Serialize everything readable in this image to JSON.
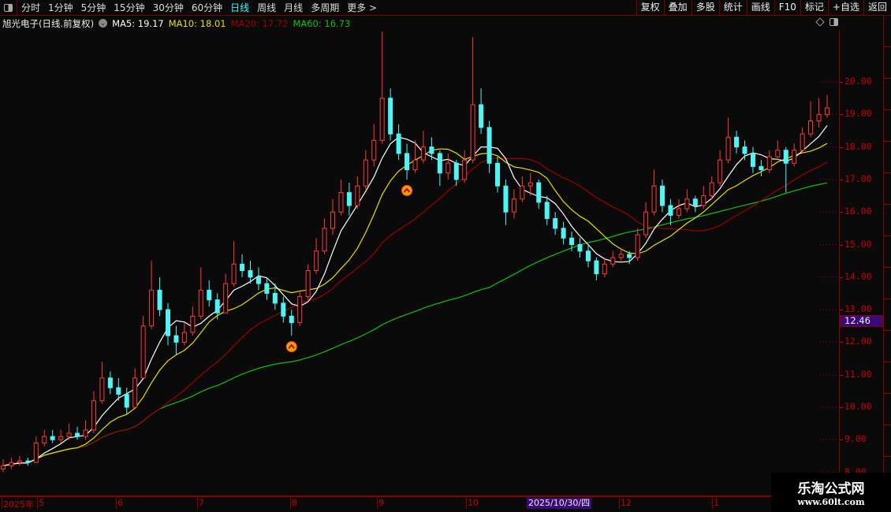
{
  "toolbar": {
    "periods": [
      "分时",
      "1分钟",
      "5分钟",
      "15分钟",
      "30分钟",
      "60分钟",
      "日线",
      "周线",
      "月线",
      "多周期",
      "更多 >"
    ],
    "active": "日线",
    "actions": [
      "复权",
      "叠加",
      "多股",
      "统计",
      "画线",
      "F10",
      "标记",
      "+自选",
      "返回"
    ]
  },
  "info": {
    "title": "旭光电子(日线.前复权)",
    "ma5": "MA5: 19.17",
    "ma10": "MA10: 18.01",
    "ma20": "MA20: 17.72",
    "ma60": "MA60: 16.73"
  },
  "colors": {
    "up": "#ff3a3a",
    "down": "#4ff5f5",
    "ma5": "#ffffff",
    "ma10": "#e8e000",
    "ma20": "#a00000",
    "ma60": "#10c010",
    "axis": "#cc0000",
    "grid": "#8a0000"
  },
  "price_label": "12.46",
  "crosshair_date": "2025/10/30/四",
  "watermark": {
    "name": "乐淘公式网",
    "url": "www.60lt.com"
  },
  "chart_data": {
    "type": "candlestick",
    "ylim": [
      7.8,
      22
    ],
    "y_ticks": [
      "20.00",
      "19.00",
      "18.00",
      "17.00",
      "16.00",
      "15.00",
      "14.00",
      "13.00",
      "12.00",
      "11.00",
      "10.00",
      "9.00",
      "8.00"
    ],
    "x_ticks": [
      "2025年",
      "5",
      "6",
      "7",
      "8",
      "9",
      "10",
      "12",
      "1"
    ],
    "series_legend": [
      "MA5",
      "MA10",
      "MA20",
      "MA60"
    ],
    "signals": [
      {
        "type": "buy-arrow",
        "candle": 35
      },
      {
        "type": "buy-arrow",
        "candle": 49
      }
    ],
    "ohlc": [
      [
        8.1,
        8.4,
        8.0,
        8.2
      ],
      [
        8.2,
        8.45,
        8.1,
        8.3
      ],
      [
        8.3,
        8.5,
        8.2,
        8.35
      ],
      [
        8.35,
        8.45,
        8.2,
        8.3
      ],
      [
        8.3,
        9.1,
        8.3,
        8.9
      ],
      [
        8.9,
        9.3,
        8.8,
        9.1
      ],
      [
        9.1,
        9.3,
        8.9,
        9.0
      ],
      [
        9.0,
        9.3,
        8.9,
        9.1
      ],
      [
        9.1,
        9.5,
        9.0,
        9.2
      ],
      [
        9.2,
        9.4,
        9.0,
        9.1
      ],
      [
        9.1,
        9.6,
        9.0,
        9.3
      ],
      [
        9.3,
        10.5,
        9.2,
        10.2
      ],
      [
        10.2,
        11.4,
        10.1,
        10.9
      ],
      [
        10.9,
        11.1,
        10.4,
        10.6
      ],
      [
        10.6,
        10.9,
        10.2,
        10.4
      ],
      [
        10.4,
        10.6,
        9.8,
        10.0
      ],
      [
        10.0,
        11.2,
        10.0,
        10.9
      ],
      [
        10.9,
        12.8,
        10.9,
        12.5
      ],
      [
        12.5,
        14.5,
        12.4,
        13.6
      ],
      [
        13.6,
        14.0,
        12.8,
        13.0
      ],
      [
        13.0,
        13.2,
        11.9,
        12.2
      ],
      [
        12.2,
        12.5,
        11.6,
        12.0
      ],
      [
        12.0,
        12.6,
        11.9,
        12.3
      ],
      [
        12.3,
        13.1,
        12.2,
        12.8
      ],
      [
        12.8,
        14.3,
        12.7,
        13.6
      ],
      [
        13.6,
        13.9,
        13.1,
        13.3
      ],
      [
        13.3,
        13.5,
        12.7,
        12.9
      ],
      [
        12.9,
        14.1,
        12.9,
        13.8
      ],
      [
        13.8,
        15.1,
        13.7,
        14.4
      ],
      [
        14.4,
        14.7,
        14.0,
        14.2
      ],
      [
        14.2,
        14.5,
        13.8,
        14.0
      ],
      [
        14.0,
        14.3,
        13.6,
        13.8
      ],
      [
        13.8,
        14.0,
        13.3,
        13.5
      ],
      [
        13.5,
        13.8,
        13.0,
        13.2
      ],
      [
        13.2,
        13.4,
        12.6,
        12.8
      ],
      [
        12.8,
        13.0,
        12.2,
        12.6
      ],
      [
        12.6,
        13.6,
        12.5,
        13.4
      ],
      [
        13.4,
        14.4,
        13.3,
        14.2
      ],
      [
        14.2,
        15.2,
        14.1,
        14.8
      ],
      [
        14.8,
        15.8,
        14.7,
        15.5
      ],
      [
        15.5,
        16.4,
        15.3,
        16.0
      ],
      [
        16.0,
        17.0,
        15.9,
        16.6
      ],
      [
        16.6,
        16.9,
        15.9,
        16.2
      ],
      [
        16.2,
        17.1,
        16.1,
        16.8
      ],
      [
        16.8,
        17.9,
        16.7,
        17.6
      ],
      [
        17.6,
        18.7,
        17.4,
        18.2
      ],
      [
        18.2,
        21.55,
        18.1,
        19.5
      ],
      [
        19.5,
        19.8,
        18.2,
        18.4
      ],
      [
        18.4,
        18.7,
        17.6,
        17.8
      ],
      [
        17.8,
        18.1,
        17.0,
        17.3
      ],
      [
        17.3,
        18.2,
        17.2,
        17.6
      ],
      [
        17.6,
        18.5,
        17.5,
        18.0
      ],
      [
        18.0,
        18.3,
        17.6,
        17.8
      ],
      [
        17.8,
        17.9,
        16.8,
        17.2
      ],
      [
        17.2,
        17.8,
        17.0,
        17.5
      ],
      [
        17.5,
        17.6,
        16.8,
        17.0
      ],
      [
        17.0,
        17.9,
        16.9,
        17.6
      ],
      [
        17.6,
        21.38,
        17.5,
        19.3
      ],
      [
        19.3,
        19.8,
        18.4,
        18.6
      ],
      [
        18.6,
        18.8,
        17.2,
        17.5
      ],
      [
        17.5,
        17.7,
        16.6,
        16.8
      ],
      [
        16.8,
        17.0,
        15.6,
        16.0
      ],
      [
        16.0,
        16.7,
        15.8,
        16.4
      ],
      [
        16.4,
        17.1,
        16.3,
        16.8
      ],
      [
        16.8,
        17.2,
        16.5,
        16.9
      ],
      [
        16.9,
        17.0,
        16.1,
        16.3
      ],
      [
        16.3,
        16.5,
        15.6,
        15.8
      ],
      [
        15.8,
        16.0,
        15.3,
        15.5
      ],
      [
        15.5,
        15.7,
        15.0,
        15.2
      ],
      [
        15.2,
        15.4,
        14.8,
        15.0
      ],
      [
        15.0,
        15.2,
        14.6,
        14.8
      ],
      [
        14.8,
        15.0,
        14.3,
        14.5
      ],
      [
        14.5,
        14.6,
        13.9,
        14.1
      ],
      [
        14.1,
        14.6,
        14.0,
        14.4
      ],
      [
        14.4,
        14.8,
        14.3,
        14.6
      ],
      [
        14.6,
        14.9,
        14.5,
        14.7
      ],
      [
        14.7,
        14.8,
        14.4,
        14.6
      ],
      [
        14.6,
        15.5,
        14.5,
        15.3
      ],
      [
        15.3,
        16.3,
        15.2,
        16.0
      ],
      [
        16.0,
        17.3,
        15.9,
        16.8
      ],
      [
        16.8,
        17.0,
        16.0,
        16.2
      ],
      [
        16.2,
        16.4,
        15.6,
        15.9
      ],
      [
        15.9,
        16.4,
        15.8,
        16.1
      ],
      [
        16.1,
        16.7,
        16.0,
        16.4
      ],
      [
        16.4,
        16.5,
        16.0,
        16.2
      ],
      [
        16.2,
        16.8,
        16.1,
        16.5
      ],
      [
        16.5,
        17.1,
        16.4,
        16.9
      ],
      [
        16.9,
        17.9,
        16.8,
        17.6
      ],
      [
        17.6,
        18.9,
        17.5,
        18.3
      ],
      [
        18.3,
        18.5,
        17.8,
        18.0
      ],
      [
        18.0,
        18.2,
        17.6,
        17.8
      ],
      [
        17.8,
        18.0,
        17.2,
        17.4
      ],
      [
        17.4,
        17.6,
        17.1,
        17.3
      ],
      [
        17.3,
        17.9,
        17.2,
        17.7
      ],
      [
        17.7,
        18.2,
        17.6,
        17.9
      ],
      [
        17.9,
        18.0,
        16.6,
        17.5
      ],
      [
        17.5,
        18.1,
        17.4,
        17.9
      ],
      [
        17.9,
        18.6,
        17.8,
        18.4
      ],
      [
        18.4,
        19.4,
        18.3,
        18.8
      ],
      [
        18.8,
        19.5,
        18.6,
        19.0
      ],
      [
        19.0,
        19.6,
        18.9,
        19.2
      ]
    ]
  }
}
